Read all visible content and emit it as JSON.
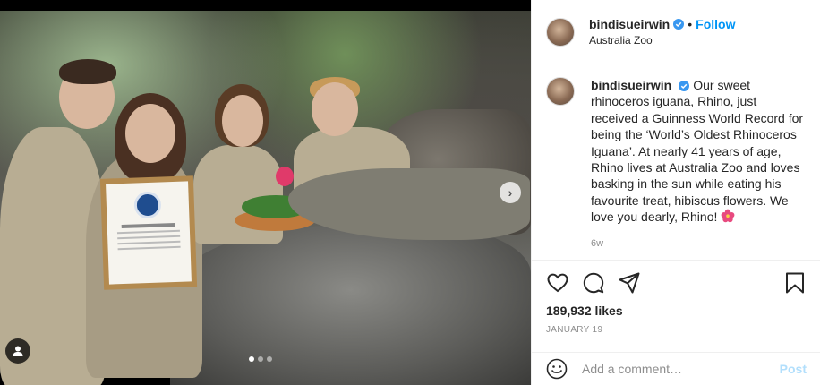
{
  "post": {
    "username": "bindisueirwin",
    "follow_label": "Follow",
    "separator": "•",
    "location": "Australia Zoo",
    "caption": "Our sweet rhinoceros iguana, Rhino, just received a Guinness World Record for being the ‘World’s Oldest Rhinoceros Iguana’. At nearly 41 years of age, Rhino lives at Australia Zoo and loves basking in the sun while eating his favourite treat, hibiscus flowers. We love you dearly, Rhino!",
    "time_ago": "6w",
    "likes": "189,932 likes",
    "date": "JANUARY 19"
  },
  "media": {
    "carousel_total": 3,
    "carousel_active": 1,
    "next_glyph": "›"
  },
  "comment": {
    "placeholder": "Add a comment…",
    "post_label": "Post"
  },
  "colors": {
    "follow": "#0095f6",
    "verified": "#3897f0",
    "post_disabled": "#b2dffc",
    "hibiscus": "#e84a7f"
  },
  "icons": [
    "verified-badge-icon",
    "heart-icon",
    "comment-icon",
    "share-icon",
    "bookmark-icon",
    "emoji-icon",
    "user-tag-icon",
    "chevron-right-icon",
    "hibiscus-icon"
  ]
}
